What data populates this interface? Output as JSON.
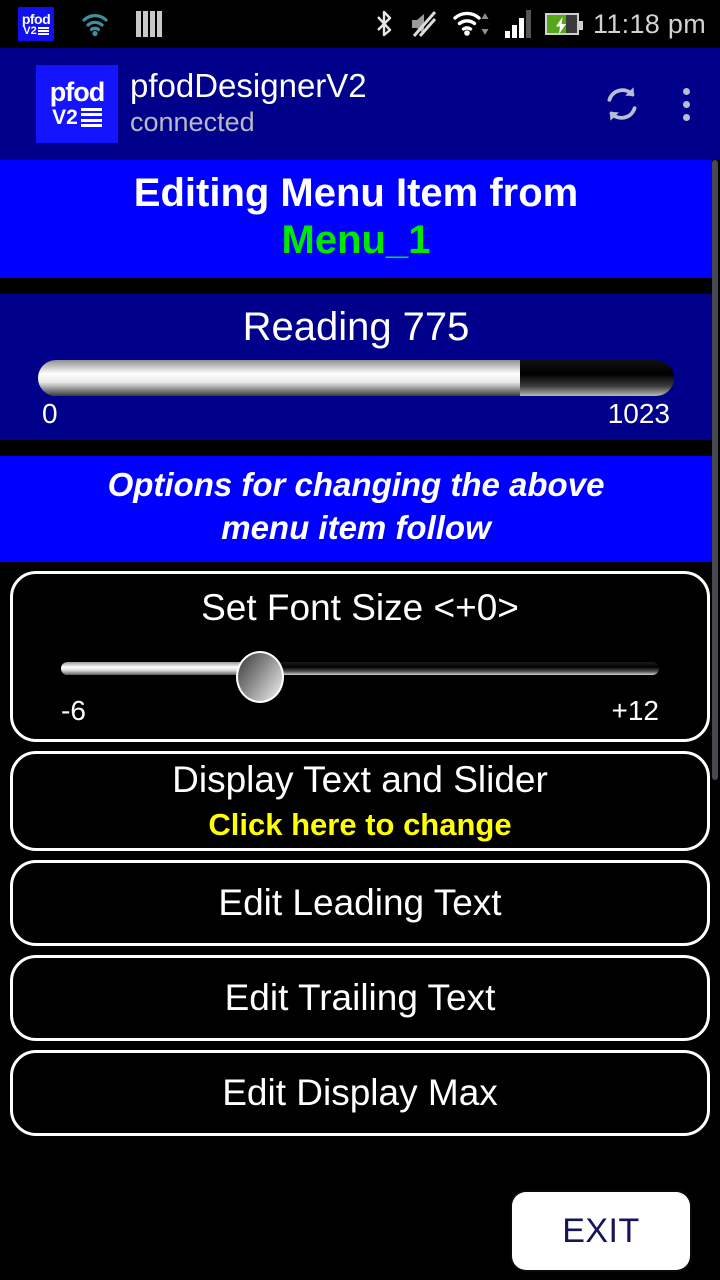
{
  "status_bar": {
    "app_badge": {
      "line1": "pfod",
      "line2": "V2",
      "icon": "pfod-notification-icon"
    },
    "wifi_notification_icon": "wifi-teal-icon",
    "bars_icon": "vertical-bars-icon",
    "bluetooth_icon": "bluetooth-icon",
    "mute_icon": "volume-muted-icon",
    "wifi_icon": "wifi-icon",
    "signal_icon": "cellular-signal-icon",
    "battery_icon": "battery-charging-icon",
    "time": "11:18 pm"
  },
  "app_bar": {
    "logo": {
      "line1": "pfod",
      "line2": "V2",
      "icon": "pfod-logo-icon"
    },
    "title": "pfodDesignerV2",
    "subtitle": "connected",
    "refresh_icon": "refresh-icon",
    "overflow_icon": "overflow-menu-icon"
  },
  "editing_banner": {
    "line1": "Editing Menu Item from",
    "line2": "Menu_1",
    "line1_color": "#FFFFFF",
    "line2_color": "#00E800",
    "background": "#0000FF"
  },
  "preview_slider": {
    "label": "Reading 775",
    "value": 775,
    "min_label": "0",
    "max_label": "1023",
    "min": 0,
    "max": 1023,
    "fill_percent": "75.8%",
    "background": "#00008B"
  },
  "options_banner": {
    "line1": "Options for changing the above",
    "line2": "menu item follow",
    "background": "#0000FF"
  },
  "font_size_card": {
    "title": "Set Font Size <+0>",
    "value": 0,
    "min_label": "-6",
    "max_label": "+12",
    "min": -6,
    "max": 12,
    "thumb_percent": "33.3%"
  },
  "option_rows": [
    {
      "label": "Display Text and Slider",
      "sublabel": "Click here to change",
      "sublabel_color": "#FFFF00"
    },
    {
      "label": "Edit Leading Text"
    },
    {
      "label": "Edit Trailing Text"
    },
    {
      "label": "Edit Display Max"
    }
  ],
  "exit_button": {
    "label": "EXIT"
  }
}
